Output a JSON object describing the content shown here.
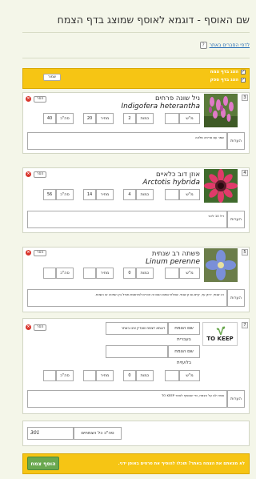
{
  "header": {
    "title": "שם האוסף - דוגמא לאוסף שמוצג בדף הצמח",
    "help_icon": "?",
    "help_link": "לדפי הסברים באתר"
  },
  "options": {
    "show_in_plant_page": "הצג בדף צמח",
    "show_in_supplier_page": "הצג בדף ספק",
    "save_label": "שמור"
  },
  "labels": {
    "price": "מחיר",
    "quantity": "כמות",
    "total": "סה\"כ",
    "unit": "מ\"ש",
    "notes": "הערות",
    "remove": "הסר"
  },
  "items": [
    {
      "index": "3",
      "hebrew_name": "ניל שונה פרחים",
      "latin_name": "Indigofera heterantha",
      "unit_value": "",
      "quantity": "2",
      "price": "20",
      "total": "40",
      "note": "שמר עם פריחה מלאה"
    },
    {
      "index": "4",
      "hebrew_name": "אוזן דוב כלאיים",
      "latin_name": "Arctotis hybrida",
      "unit_value": "",
      "quantity": "4",
      "price": "14",
      "total": "56",
      "note": "דיל 10 ליטר"
    },
    {
      "index": "5",
      "hebrew_name": "פשתה רב שנתית",
      "latin_name": "Linum perenne",
      "unit_value": "",
      "quantity": "0",
      "price": "",
      "total": "",
      "note": "רב שנתי, ירוק עד, קיים גם זן שנתי. שאלת אותם האם זה זוכרים למרפסת מגדל בין השיטה או השטח."
    }
  ],
  "custom_item": {
    "index": "7",
    "logo_text": "TO KEEP",
    "name_he_label": "שם הצמח בעברית",
    "name_he_value": "דוגמא לצמח שעדיין אינו באתר",
    "name_latin_label": "שם הצמח בלועזית",
    "name_latin_value": "",
    "unit_value": "",
    "quantity": "0",
    "price": "",
    "total": "",
    "note": "ספרו לנו על הצמח, כדי שנוסיף לאתר TO KEEP"
  },
  "summary": {
    "label": "סה\"כ כל הצמחים",
    "value": "301"
  },
  "footer": {
    "message": "לא מצאתם את הצמח באתר? תוכלו להוסיף את פרטים באופן ידני.",
    "add_button": "הוסף צמח"
  },
  "colors": {
    "accent_yellow": "#f6c514",
    "add_green": "#6aa84f",
    "remove_red": "#d9352c",
    "link_blue": "#2a6fb6"
  }
}
